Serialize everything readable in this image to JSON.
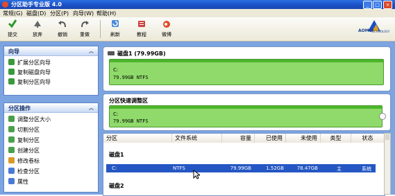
{
  "window": {
    "title": "分区助手专业版 4.0",
    "buttons": [
      "_",
      "□",
      "×"
    ]
  },
  "menu": [
    "常规(G)",
    "磁盘(D)",
    "分区(P)",
    "向导(W)",
    "帮助(H)"
  ],
  "toolbar": {
    "items": [
      {
        "label": "提交",
        "icon": "check-icon"
      },
      {
        "label": "放弃",
        "icon": "discard-icon"
      },
      {
        "label": "撤销",
        "icon": "undo-icon"
      },
      {
        "label": "重做",
        "icon": "redo-icon"
      },
      {
        "label": "刷新",
        "icon": "refresh-icon"
      },
      {
        "label": "教程",
        "icon": "tutorial-icon"
      },
      {
        "label": "微博",
        "icon": "weibo-icon"
      }
    ]
  },
  "logo": {
    "line1": "AOMEI",
    "line2": "TECHNOLOGY"
  },
  "sidebar": {
    "wizard": {
      "title": "向导",
      "items": [
        "扩展分区向导",
        "复制磁盘向导",
        "复制分区向导"
      ]
    },
    "ops": {
      "title": "分区操作",
      "items": [
        "调整分区大小",
        "切割分区",
        "复制分区",
        "创建分区",
        "修改卷标",
        "检查分区",
        "属性"
      ]
    }
  },
  "disk1": {
    "header": "磁盘1 (79.99GB)",
    "part_letter": "C:",
    "part_info": "79.99GB NTFS"
  },
  "quick": {
    "header": "分区快速调整区",
    "part_letter": "C:",
    "part_info": "79.99GB NTFS"
  },
  "table": {
    "headers": [
      "分区",
      "文件系统",
      "容量",
      "已使用",
      "未使用",
      "类型",
      "状态"
    ],
    "group1": "磁盘1",
    "row": [
      "C:",
      "NTFS",
      "79.99GB",
      "1.52GB",
      "78.47GB",
      "主",
      "系统"
    ],
    "group2": "磁盘2"
  },
  "colors": {
    "accent": "#2457c4",
    "partition": "#8fda6a",
    "panel": "#7ba4e0"
  }
}
